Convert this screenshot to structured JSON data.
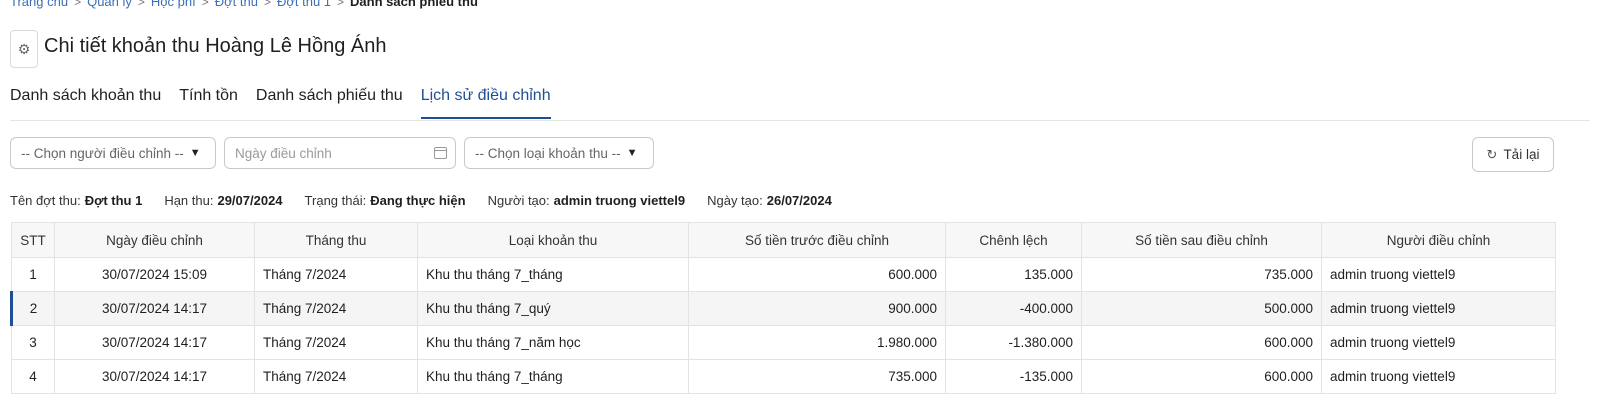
{
  "breadcrumb": {
    "items": [
      "Trang chủ",
      "Quản lý",
      "Học phí",
      "Đợt thu",
      "Đợt thu 1"
    ],
    "current": "Danh sách phiếu thu"
  },
  "page": {
    "title": "Chi tiết khoản thu Hoàng Lê Hồng Ánh"
  },
  "tabs": [
    {
      "label": "Danh sách khoản thu",
      "active": false
    },
    {
      "label": "Tính tồn",
      "active": false
    },
    {
      "label": "Danh sách phiếu thu",
      "active": false
    },
    {
      "label": "Lịch sử điều chỉnh",
      "active": true
    }
  ],
  "filters": {
    "adjuster_select": "-- Chọn người điều chỉnh --",
    "date_placeholder": "Ngày điều chỉnh",
    "type_select": "-- Chọn loại khoản thu --",
    "reload_label": "Tải lại"
  },
  "info": {
    "period_label": "Tên đợt thu:",
    "period_value": "Đợt thu 1",
    "deadline_label": "Hạn thu:",
    "deadline_value": "29/07/2024",
    "status_label": "Trạng thái:",
    "status_value": "Đang thực hiện",
    "creator_label": "Người tạo:",
    "creator_value": "admin truong viettel9",
    "created_label": "Ngày tạo:",
    "created_value": "26/07/2024"
  },
  "table": {
    "headers": [
      "STT",
      "Ngày điều chỉnh",
      "Tháng thu",
      "Loại khoản thu",
      "Số tiền trước điều chỉnh",
      "Chênh lệch",
      "Số tiền sau điều chỉnh",
      "Người điều chỉnh"
    ],
    "rows": [
      [
        "1",
        "30/07/2024 15:09",
        "Tháng 7/2024",
        "Khu thu tháng 7_tháng",
        "600.000",
        "135.000",
        "735.000",
        "admin truong viettel9"
      ],
      [
        "2",
        "30/07/2024 14:17",
        "Tháng 7/2024",
        "Khu thu tháng 7_quý",
        "900.000",
        "-400.000",
        "500.000",
        "admin truong viettel9"
      ],
      [
        "3",
        "30/07/2024 14:17",
        "Tháng 7/2024",
        "Khu thu tháng 7_năm học",
        "1.980.000",
        "-1.380.000",
        "600.000",
        "admin truong viettel9"
      ],
      [
        "4",
        "30/07/2024 14:17",
        "Tháng 7/2024",
        "Khu thu tháng 7_tháng",
        "735.000",
        "-135.000",
        "600.000",
        "admin truong viettel9"
      ]
    ]
  }
}
